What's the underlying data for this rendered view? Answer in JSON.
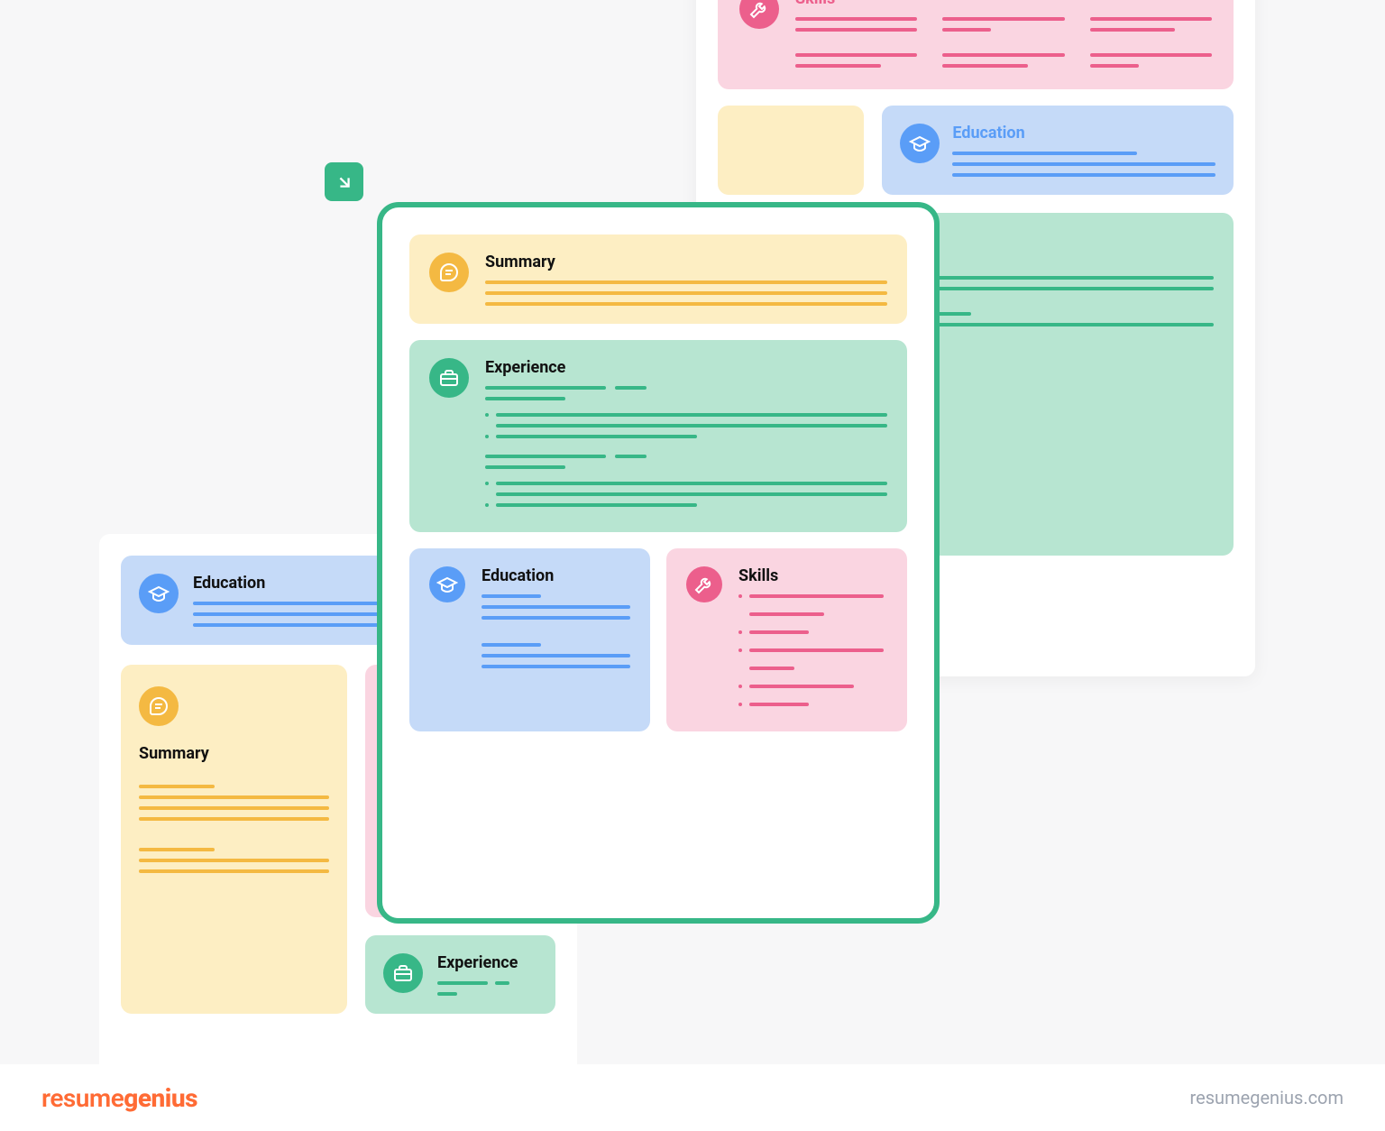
{
  "drag_icon": "arrow-down-right",
  "main_template": {
    "summary": {
      "label": "Summary"
    },
    "experience": {
      "label": "Experience"
    },
    "education": {
      "label": "Education"
    },
    "skills": {
      "label": "Skills"
    }
  },
  "left_template": {
    "education": {
      "label": "Education"
    },
    "summary": {
      "label": "Summary"
    },
    "experience": {
      "label": "Experience"
    }
  },
  "right_template": {
    "skills": {
      "label": "Skills"
    },
    "education": {
      "label": "Education"
    }
  },
  "footer": {
    "brand_regular": "resume",
    "brand_bold": "genius",
    "url": "resumegenius.com"
  }
}
